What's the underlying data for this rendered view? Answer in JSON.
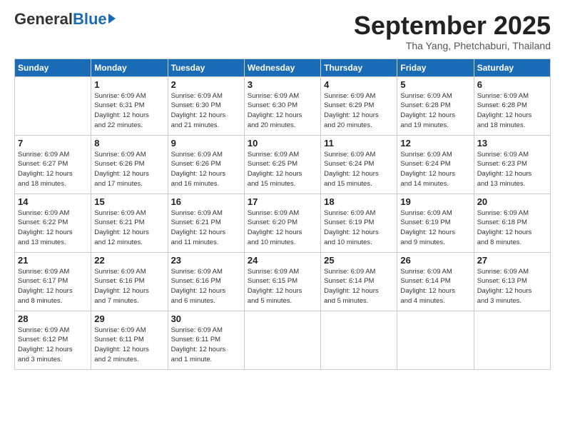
{
  "logo": {
    "general": "General",
    "blue": "Blue"
  },
  "header": {
    "title": "September 2025",
    "location": "Tha Yang, Phetchaburi, Thailand"
  },
  "weekdays": [
    "Sunday",
    "Monday",
    "Tuesday",
    "Wednesday",
    "Thursday",
    "Friday",
    "Saturday"
  ],
  "weeks": [
    [
      {
        "day": "",
        "info": ""
      },
      {
        "day": "1",
        "info": "Sunrise: 6:09 AM\nSunset: 6:31 PM\nDaylight: 12 hours\nand 22 minutes."
      },
      {
        "day": "2",
        "info": "Sunrise: 6:09 AM\nSunset: 6:30 PM\nDaylight: 12 hours\nand 21 minutes."
      },
      {
        "day": "3",
        "info": "Sunrise: 6:09 AM\nSunset: 6:30 PM\nDaylight: 12 hours\nand 20 minutes."
      },
      {
        "day": "4",
        "info": "Sunrise: 6:09 AM\nSunset: 6:29 PM\nDaylight: 12 hours\nand 20 minutes."
      },
      {
        "day": "5",
        "info": "Sunrise: 6:09 AM\nSunset: 6:28 PM\nDaylight: 12 hours\nand 19 minutes."
      },
      {
        "day": "6",
        "info": "Sunrise: 6:09 AM\nSunset: 6:28 PM\nDaylight: 12 hours\nand 18 minutes."
      }
    ],
    [
      {
        "day": "7",
        "info": "Sunrise: 6:09 AM\nSunset: 6:27 PM\nDaylight: 12 hours\nand 18 minutes."
      },
      {
        "day": "8",
        "info": "Sunrise: 6:09 AM\nSunset: 6:26 PM\nDaylight: 12 hours\nand 17 minutes."
      },
      {
        "day": "9",
        "info": "Sunrise: 6:09 AM\nSunset: 6:26 PM\nDaylight: 12 hours\nand 16 minutes."
      },
      {
        "day": "10",
        "info": "Sunrise: 6:09 AM\nSunset: 6:25 PM\nDaylight: 12 hours\nand 15 minutes."
      },
      {
        "day": "11",
        "info": "Sunrise: 6:09 AM\nSunset: 6:24 PM\nDaylight: 12 hours\nand 15 minutes."
      },
      {
        "day": "12",
        "info": "Sunrise: 6:09 AM\nSunset: 6:24 PM\nDaylight: 12 hours\nand 14 minutes."
      },
      {
        "day": "13",
        "info": "Sunrise: 6:09 AM\nSunset: 6:23 PM\nDaylight: 12 hours\nand 13 minutes."
      }
    ],
    [
      {
        "day": "14",
        "info": "Sunrise: 6:09 AM\nSunset: 6:22 PM\nDaylight: 12 hours\nand 13 minutes."
      },
      {
        "day": "15",
        "info": "Sunrise: 6:09 AM\nSunset: 6:21 PM\nDaylight: 12 hours\nand 12 minutes."
      },
      {
        "day": "16",
        "info": "Sunrise: 6:09 AM\nSunset: 6:21 PM\nDaylight: 12 hours\nand 11 minutes."
      },
      {
        "day": "17",
        "info": "Sunrise: 6:09 AM\nSunset: 6:20 PM\nDaylight: 12 hours\nand 10 minutes."
      },
      {
        "day": "18",
        "info": "Sunrise: 6:09 AM\nSunset: 6:19 PM\nDaylight: 12 hours\nand 10 minutes."
      },
      {
        "day": "19",
        "info": "Sunrise: 6:09 AM\nSunset: 6:19 PM\nDaylight: 12 hours\nand 9 minutes."
      },
      {
        "day": "20",
        "info": "Sunrise: 6:09 AM\nSunset: 6:18 PM\nDaylight: 12 hours\nand 8 minutes."
      }
    ],
    [
      {
        "day": "21",
        "info": "Sunrise: 6:09 AM\nSunset: 6:17 PM\nDaylight: 12 hours\nand 8 minutes."
      },
      {
        "day": "22",
        "info": "Sunrise: 6:09 AM\nSunset: 6:16 PM\nDaylight: 12 hours\nand 7 minutes."
      },
      {
        "day": "23",
        "info": "Sunrise: 6:09 AM\nSunset: 6:16 PM\nDaylight: 12 hours\nand 6 minutes."
      },
      {
        "day": "24",
        "info": "Sunrise: 6:09 AM\nSunset: 6:15 PM\nDaylight: 12 hours\nand 5 minutes."
      },
      {
        "day": "25",
        "info": "Sunrise: 6:09 AM\nSunset: 6:14 PM\nDaylight: 12 hours\nand 5 minutes."
      },
      {
        "day": "26",
        "info": "Sunrise: 6:09 AM\nSunset: 6:14 PM\nDaylight: 12 hours\nand 4 minutes."
      },
      {
        "day": "27",
        "info": "Sunrise: 6:09 AM\nSunset: 6:13 PM\nDaylight: 12 hours\nand 3 minutes."
      }
    ],
    [
      {
        "day": "28",
        "info": "Sunrise: 6:09 AM\nSunset: 6:12 PM\nDaylight: 12 hours\nand 3 minutes."
      },
      {
        "day": "29",
        "info": "Sunrise: 6:09 AM\nSunset: 6:11 PM\nDaylight: 12 hours\nand 2 minutes."
      },
      {
        "day": "30",
        "info": "Sunrise: 6:09 AM\nSunset: 6:11 PM\nDaylight: 12 hours\nand 1 minute."
      },
      {
        "day": "",
        "info": ""
      },
      {
        "day": "",
        "info": ""
      },
      {
        "day": "",
        "info": ""
      },
      {
        "day": "",
        "info": ""
      }
    ]
  ]
}
